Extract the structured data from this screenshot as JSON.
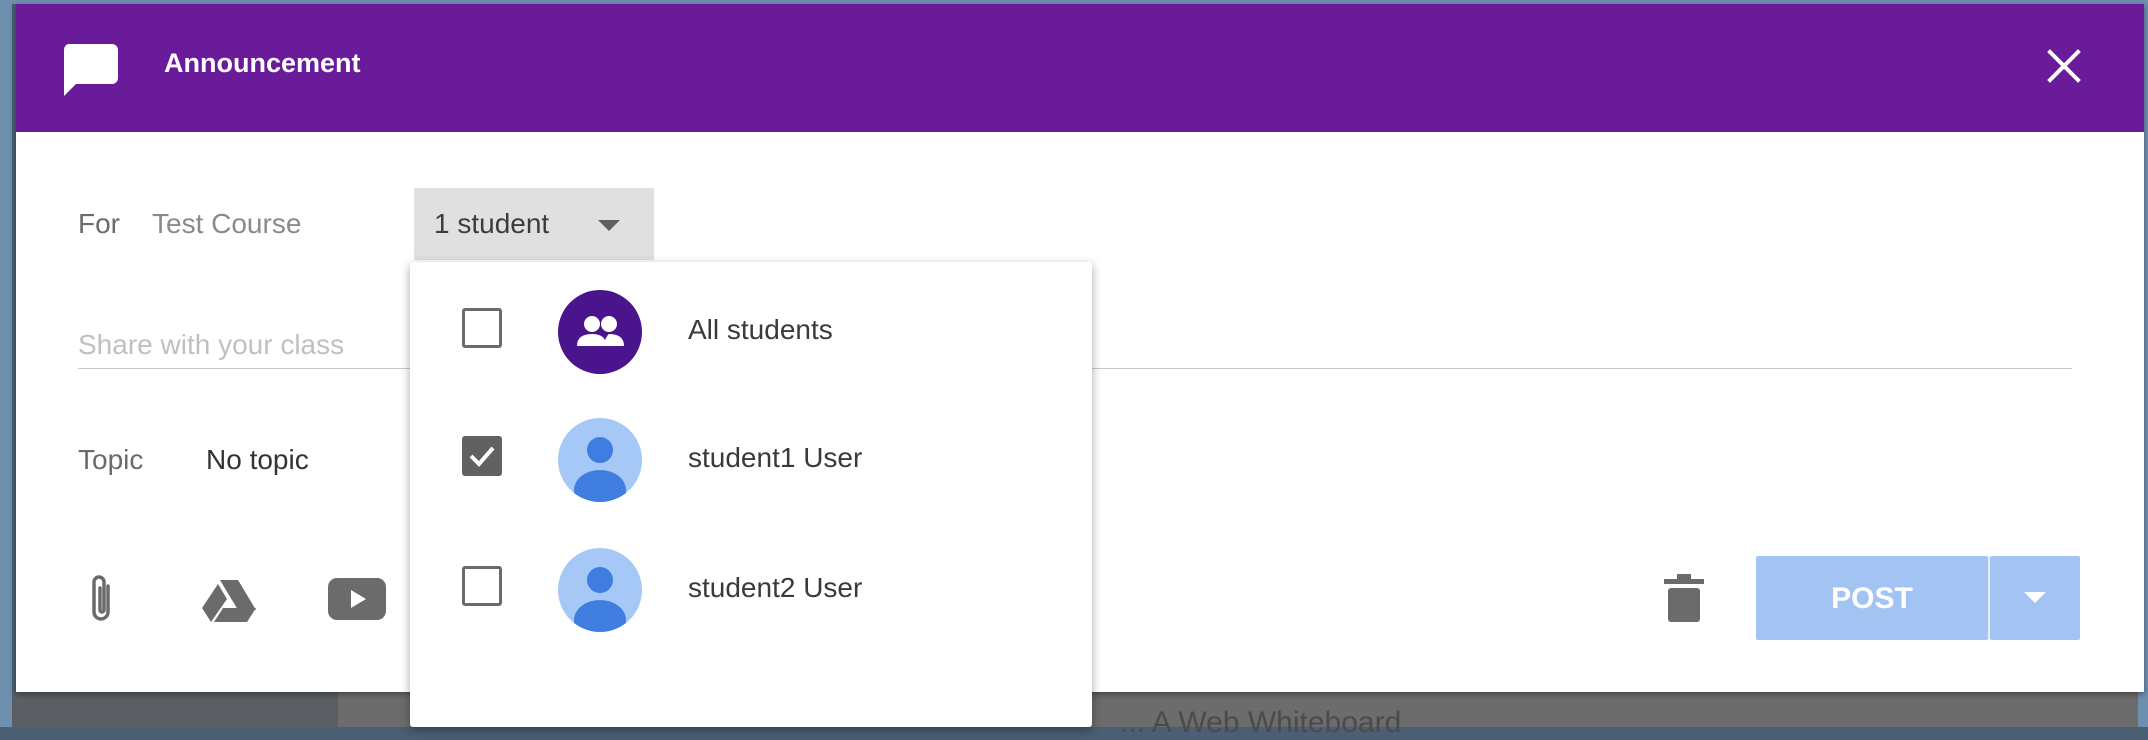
{
  "dialog": {
    "title": "Announcement",
    "for_label": "For",
    "course": "Test Course",
    "audience_select": "1 student",
    "share_placeholder": "Share with your class",
    "topic_label": "Topic",
    "topic_value": "No topic",
    "post_button": "POST"
  },
  "audience_menu": {
    "items": [
      {
        "label": "All students",
        "checked": false,
        "avatar": "group-icon"
      },
      {
        "label": "student1 User",
        "checked": true,
        "avatar": "person-icon"
      },
      {
        "label": "student2 User",
        "checked": false,
        "avatar": "person-icon"
      }
    ]
  },
  "background": {
    "partial_text": "... A Web Whiteboard"
  },
  "colors": {
    "header": "#6a1b9a",
    "group_avatar": "#4a148c",
    "person_avatar": "#a6c8f6",
    "post_button": "#a3c4f3"
  }
}
